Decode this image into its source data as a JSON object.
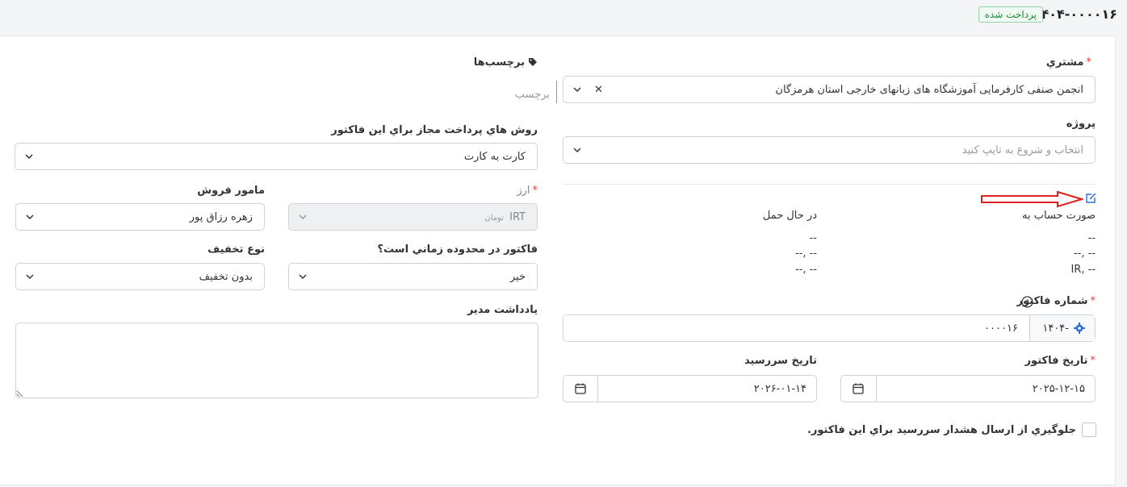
{
  "header": {
    "invoice_number": "۱۴۰۴-۰۰۰۰۱۶",
    "status": "پرداخت شده"
  },
  "customer": {
    "label": "مشتري",
    "value": "انجمن صنفی کارفرمایی آموزشگاه های زبانهای خارجی استان هرمزگان"
  },
  "project": {
    "label": "پروژه",
    "placeholder": "انتخاب و شروع به تایپ کنید"
  },
  "billing": {
    "bill_to_label": "صورت حساب به",
    "ship_to_label": "در حال حمل",
    "bill_line1": "--",
    "bill_line2": "-- ,--",
    "bill_line3": "-- ,IR",
    "ship_line1": "--",
    "ship_line2": "-- ,--",
    "ship_line3": "-- ,--"
  },
  "invoice_number_field": {
    "label": "شماره فاكتور",
    "prefix": "-۱۴۰۴",
    "value": "۰۰۰۰۱۶"
  },
  "invoice_date": {
    "label": "تاريخ فاكتور",
    "value": "۲۰۲۵-۱۲-۱۵"
  },
  "due_date": {
    "label": "تاريخ سررسيد",
    "value": "۲۰۲۶-۰۱-۱۴"
  },
  "prevent_overdue": {
    "label": "جلوگيري از ارسال هشدار سررسيد براي اين فاكتور."
  },
  "tags": {
    "label": "برچسب‌ها",
    "placeholder": "برچسب"
  },
  "payment_modes": {
    "label": "روش هاي پرداخت مجاز براي اين فاكتور",
    "value": "کارت به کارت"
  },
  "currency": {
    "label": "ارز",
    "code": "IRT",
    "name": "تومان"
  },
  "sale_agent": {
    "label": "مامور فروش",
    "value": "زهره رزاق پور"
  },
  "recurring": {
    "label": "فاكتور در محدوده زماني است؟",
    "value": "خير"
  },
  "discount_type": {
    "label": "نوع تخفيف",
    "value": "بدون تخفيف"
  },
  "admin_note": {
    "label": "يادداشت مدير"
  },
  "colors": {
    "accent": "#2d6fd6",
    "required": "#e53935",
    "badge_green": "#22863a",
    "arrow_red": "#e02020"
  }
}
